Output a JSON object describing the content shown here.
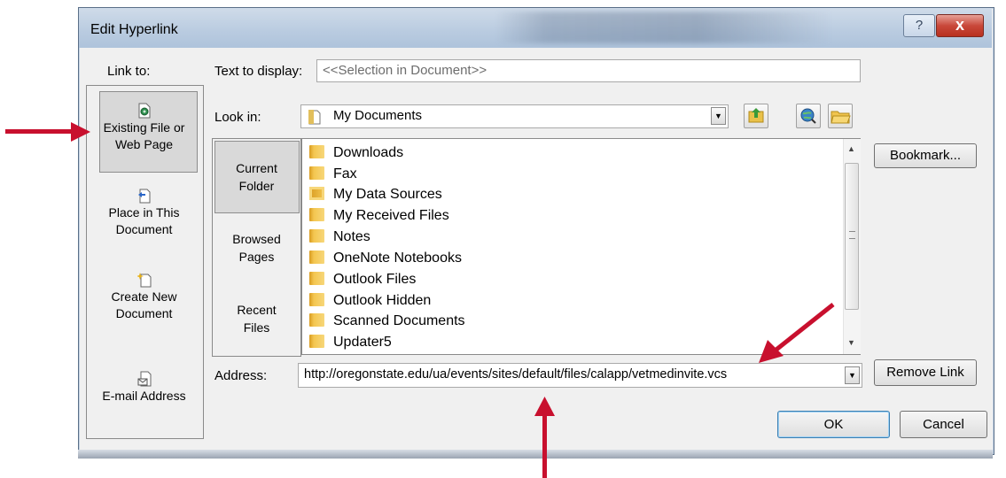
{
  "window": {
    "title": "Edit Hyperlink",
    "help_label": "?",
    "close_label": "x"
  },
  "link_to": {
    "label": "Link to:",
    "items": [
      {
        "line1": "Existing File or",
        "line2": "Web Page",
        "icon": "existing-file-icon",
        "selected": true
      },
      {
        "line1": "Place in This",
        "line2": "Document",
        "icon": "place-in-document-icon"
      },
      {
        "line1": "Create New",
        "line2": "Document",
        "icon": "create-new-document-icon"
      },
      {
        "line1": "E-mail Address",
        "line2": "",
        "icon": "email-address-icon"
      }
    ]
  },
  "text_to_display": {
    "label": "Text to display:",
    "value": "<<Selection in Document>>"
  },
  "look_in": {
    "label": "Look in:",
    "value": "My Documents",
    "icons": [
      "up-folder-icon",
      "browse-web-icon",
      "browse-file-icon"
    ]
  },
  "places": [
    {
      "line1": "Current",
      "line2": "Folder",
      "selected": true
    },
    {
      "line1": "Browsed",
      "line2": "Pages"
    },
    {
      "line1": "Recent",
      "line2": "Files"
    }
  ],
  "files": [
    "Downloads",
    "Fax",
    "My Data Sources",
    "My Received Files",
    "Notes",
    "OneNote Notebooks",
    "Outlook Files",
    "Outlook Hidden",
    "Scanned Documents",
    "Updater5"
  ],
  "address": {
    "label": "Address:",
    "value": "http://oregonstate.edu/ua/events/sites/default/files/calapp/vetmedinvite.vcs"
  },
  "buttons": {
    "bookmark": "Bookmark...",
    "remove_link": "Remove Link",
    "ok": "OK",
    "cancel": "Cancel"
  },
  "colors": {
    "annotation_arrow": "#c8102e",
    "title_bar": "#b9cbe0",
    "dialog_bg": "#f0f0f0"
  }
}
